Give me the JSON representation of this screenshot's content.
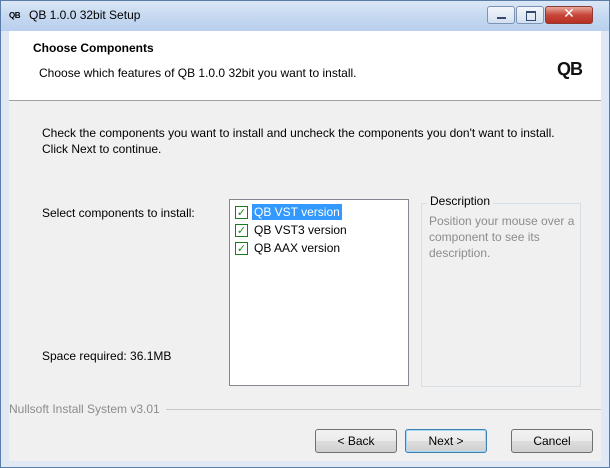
{
  "window": {
    "app_icon_text": "QB",
    "title": "QB 1.0.0 32bit Setup",
    "controls": {
      "minimize": "minimize-icon",
      "maximize": "maximize-icon",
      "close": "✕"
    }
  },
  "header": {
    "title": "Choose Components",
    "subtitle": "Choose which features of QB 1.0.0 32bit you want to install.",
    "logo_text": "QB"
  },
  "body": {
    "intro": "Check the components you want to install and uncheck the components you don't want to install. Click Next to continue.",
    "select_label": "Select components to install:",
    "space_required": "Space required: 36.1MB",
    "components": [
      {
        "label": "QB VST version",
        "checked": true,
        "selected": true
      },
      {
        "label": "QB VST3 version",
        "checked": true,
        "selected": false
      },
      {
        "label": "QB AAX version",
        "checked": true,
        "selected": false
      }
    ],
    "description": {
      "title": "Description",
      "text": "Position your mouse over a component to see its description."
    }
  },
  "footer": {
    "branding": "Nullsoft Install System v3.01",
    "buttons": {
      "back": "< Back",
      "next": "Next >",
      "cancel": "Cancel"
    }
  },
  "colors": {
    "selection": "#3399ff",
    "check": "#1a8f1a",
    "title_bar": "#c6d9f1"
  }
}
